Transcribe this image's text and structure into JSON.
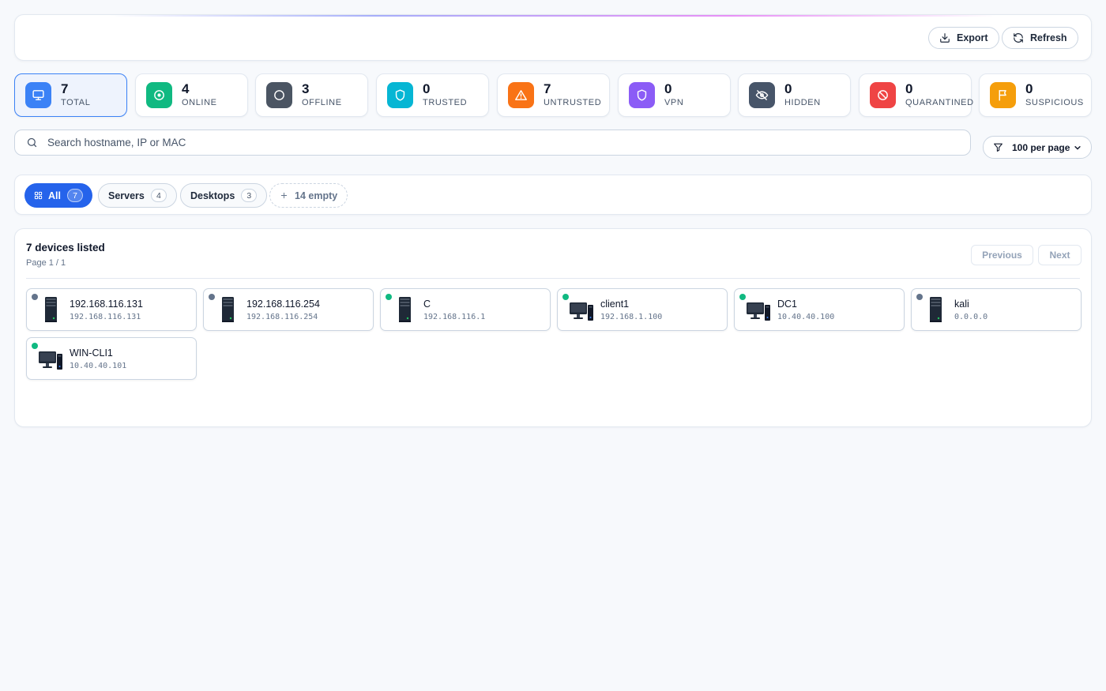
{
  "header": {
    "export_label": "Export",
    "refresh_label": "Refresh"
  },
  "stats": [
    {
      "value": "7",
      "label": "TOTAL",
      "icon": "monitor-icon",
      "color": "#3b82f6",
      "active": true
    },
    {
      "value": "4",
      "label": "ONLINE",
      "icon": "online-icon",
      "color": "#10b981"
    },
    {
      "value": "3",
      "label": "OFFLINE",
      "icon": "offline-icon",
      "color": "#4b5563"
    },
    {
      "value": "0",
      "label": "TRUSTED",
      "icon": "shield-icon",
      "color": "#06b6d4"
    },
    {
      "value": "7",
      "label": "UNTRUSTED",
      "icon": "warning-icon",
      "color": "#f97316"
    },
    {
      "value": "0",
      "label": "VPN",
      "icon": "vpn-shield-icon",
      "color": "#8b5cf6"
    },
    {
      "value": "0",
      "label": "HIDDEN",
      "icon": "eye-off-icon",
      "color": "#475569"
    },
    {
      "value": "0",
      "label": "QUARANTINED",
      "icon": "ban-icon",
      "color": "#ef4444"
    },
    {
      "value": "0",
      "label": "SUSPICIOUS",
      "icon": "flag-icon",
      "color": "#f59e0b"
    }
  ],
  "search": {
    "placeholder": "Search hostname, IP or MAC",
    "value": ""
  },
  "per_page": {
    "selected": "100 per page"
  },
  "filters": {
    "all": {
      "label": "All",
      "count": "7"
    },
    "servers": {
      "label": "Servers",
      "count": "4"
    },
    "desktops": {
      "label": "Desktops",
      "count": "3"
    },
    "empty": {
      "label": "14 empty"
    }
  },
  "list": {
    "title": "7 devices listed",
    "page_info": "Page 1 / 1",
    "prev_label": "Previous",
    "next_label": "Next"
  },
  "devices": [
    {
      "name": "192.168.116.131",
      "ip": "192.168.116.131",
      "type": "server",
      "status": "offline"
    },
    {
      "name": "192.168.116.254",
      "ip": "192.168.116.254",
      "type": "server",
      "status": "offline"
    },
    {
      "name": "C",
      "ip": "192.168.116.1",
      "type": "server",
      "status": "online"
    },
    {
      "name": "client1",
      "ip": "192.168.1.100",
      "type": "desktop",
      "status": "online"
    },
    {
      "name": "DC1",
      "ip": "10.40.40.100",
      "type": "desktop",
      "status": "online"
    },
    {
      "name": "kali",
      "ip": "0.0.0.0",
      "type": "server",
      "status": "offline"
    },
    {
      "name": "WIN-CLI1",
      "ip": "10.40.40.101",
      "type": "desktop",
      "status": "online"
    }
  ],
  "colors": {
    "online": "#10b981",
    "offline": "#64748b",
    "accent": "#2563eb"
  }
}
